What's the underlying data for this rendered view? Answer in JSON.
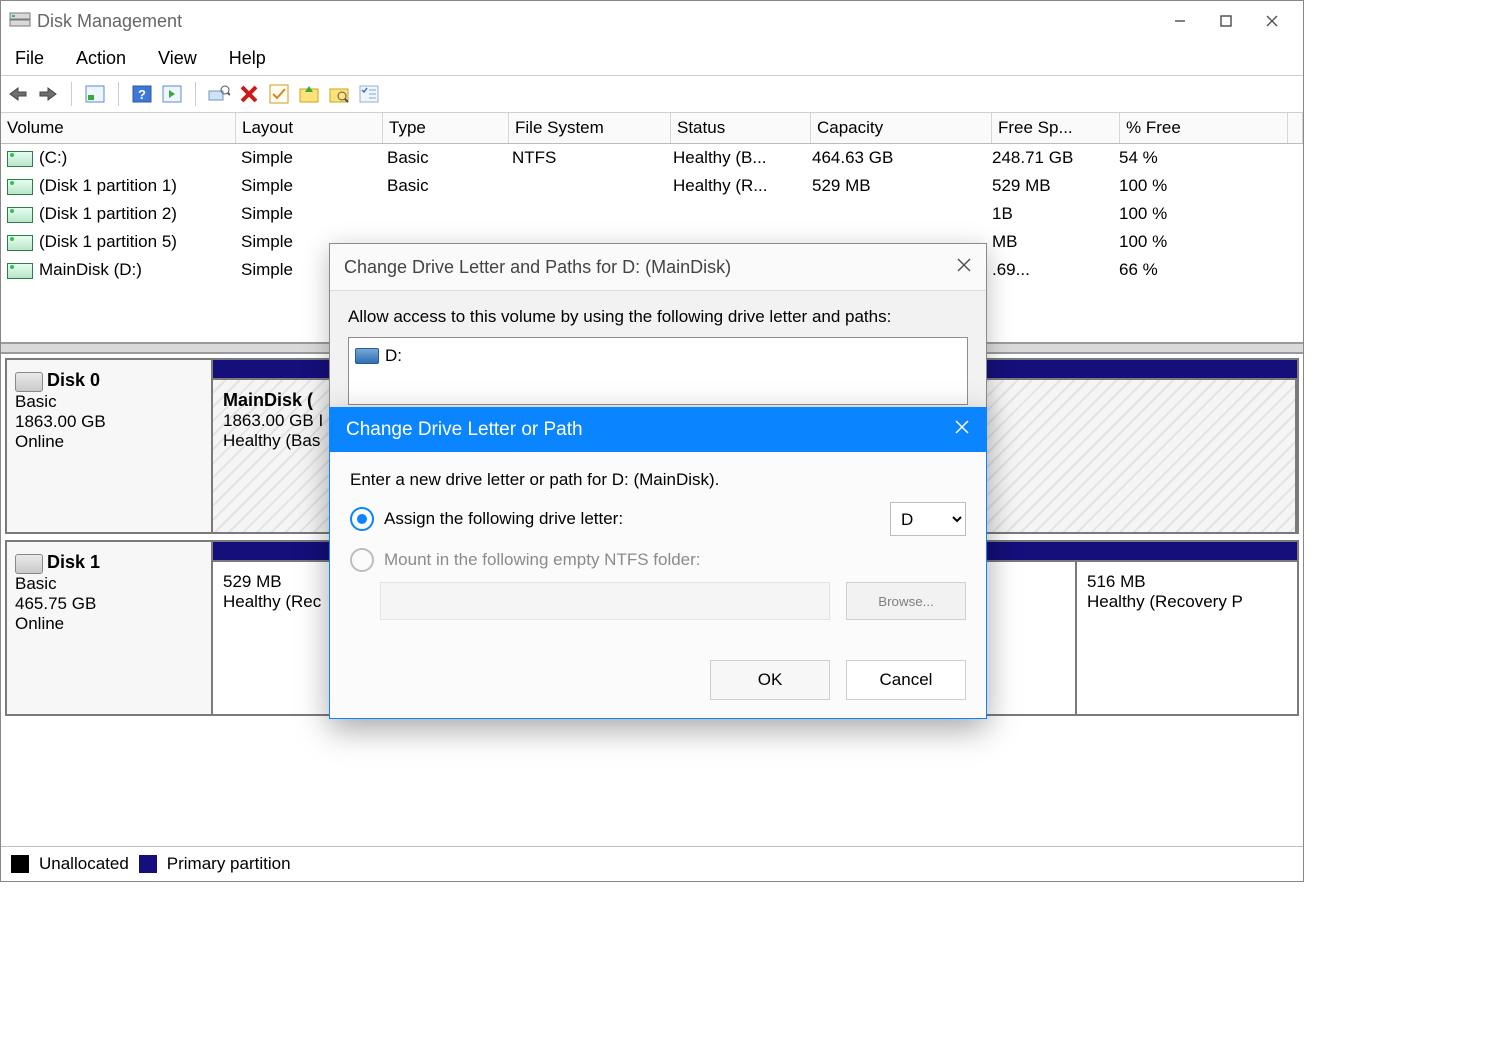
{
  "window": {
    "title": "Disk Management",
    "menubar": [
      "File",
      "Action",
      "View",
      "Help"
    ],
    "legend": {
      "unallocated": "Unallocated",
      "primary": "Primary partition"
    }
  },
  "columns": [
    "Volume",
    "Layout",
    "Type",
    "File System",
    "Status",
    "Capacity",
    "Free Sp...",
    "% Free"
  ],
  "volumes": [
    {
      "name": "(C:)",
      "layout": "Simple",
      "type": "Basic",
      "fs": "NTFS",
      "status": "Healthy (B...",
      "capacity": "464.63 GB",
      "free": "248.71 GB",
      "pct": "54 %"
    },
    {
      "name": "(Disk 1 partition 1)",
      "layout": "Simple",
      "type": "Basic",
      "fs": "",
      "status": "Healthy (R...",
      "capacity": "529 MB",
      "free": "529 MB",
      "pct": "100 %"
    },
    {
      "name": "(Disk 1 partition 2)",
      "layout": "Simple",
      "type": "",
      "fs": "",
      "status": "",
      "capacity": "",
      "free": "1B",
      "pct": "100 %"
    },
    {
      "name": "(Disk 1 partition 5)",
      "layout": "Simple",
      "type": "",
      "fs": "",
      "status": "",
      "capacity": "",
      "free": "MB",
      "pct": "100 %"
    },
    {
      "name": "MainDisk (D:)",
      "layout": "Simple",
      "type": "",
      "fs": "",
      "status": "",
      "capacity": "",
      "free": ".69...",
      "pct": "66 %"
    }
  ],
  "disks": [
    {
      "label": "Disk 0",
      "type": "Basic",
      "size": "1863.00 GB",
      "state": "Online",
      "parts": [
        {
          "name": "MainDisk  (",
          "l2": "1863.00 GB  I",
          "l3": "Healthy (Bas"
        }
      ]
    },
    {
      "label": "Disk 1",
      "type": "Basic",
      "size": "465.75 GB",
      "state": "Online",
      "parts": [
        {
          "name": "",
          "l2": "529 MB",
          "l3": "Healthy (Rec"
        },
        {
          "name": "",
          "l2": "",
          "l3": ""
        },
        {
          "name": "",
          "l2": "516 MB",
          "l3": "Healthy (Recovery P"
        }
      ]
    }
  ],
  "dlg1": {
    "title": "Change Drive Letter and Paths for D: (MainDisk)",
    "instruction": "Allow access to this volume by using the following drive letter and paths:",
    "item": "D:"
  },
  "dlg2": {
    "title": "Change Drive Letter or Path",
    "instruction": "Enter a new drive letter or path for D: (MainDisk).",
    "radio_assign": "Assign the following drive letter:",
    "radio_mount": "Mount in the following empty NTFS folder:",
    "drive_value": "D",
    "browse": "Browse...",
    "ok": "OK",
    "cancel": "Cancel"
  }
}
